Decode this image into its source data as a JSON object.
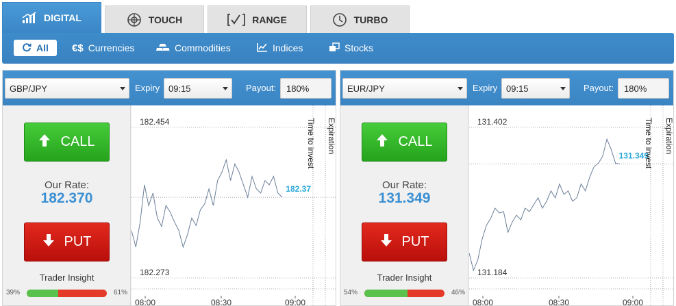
{
  "tabs": [
    {
      "label": "DIGITAL",
      "icon": "chart-up-icon",
      "active": true
    },
    {
      "label": "TOUCH",
      "icon": "target-icon",
      "active": false
    },
    {
      "label": "RANGE",
      "icon": "range-icon",
      "active": false
    },
    {
      "label": "TURBO",
      "icon": "clock-icon",
      "active": false
    }
  ],
  "categories": [
    {
      "label": "All",
      "icon": "refresh-icon",
      "active": true
    },
    {
      "label": "Currencies",
      "icon": "currency-icon",
      "active": false
    },
    {
      "label": "Commodities",
      "icon": "gold-bars-icon",
      "active": false
    },
    {
      "label": "Indices",
      "icon": "line-chart-icon",
      "active": false
    },
    {
      "label": "Stocks",
      "icon": "stocks-icon",
      "active": false
    }
  ],
  "panels": [
    {
      "asset": "GBP/JPY",
      "expiry_label": "Expiry",
      "expiry": "09:15",
      "payout_label": "Payout:",
      "payout": "180%",
      "call_label": "CALL",
      "put_label": "PUT",
      "rate_label": "Our Rate:",
      "rate": "182.370",
      "insight_label": "Trader Insight",
      "insight_put": "39%",
      "insight_call": "61%",
      "insight_fraction": 0.39,
      "chart_data": {
        "type": "line",
        "y_high_label": "182.454",
        "y_low_label": "182.273",
        "current_label": "182.37",
        "x_ticks": [
          "08:00",
          "08:30",
          "09:00"
        ],
        "markers": [
          "Time to invest",
          "Expiration"
        ],
        "x": [
          0,
          2,
          4,
          6,
          8,
          10,
          12,
          14,
          16,
          18,
          20,
          22,
          24,
          26,
          28,
          30,
          32,
          34,
          36,
          38,
          40,
          42,
          44,
          46,
          48,
          50,
          52,
          54,
          56,
          58,
          60,
          62,
          64,
          66,
          68,
          70
        ],
        "values": [
          182.33,
          182.31,
          182.34,
          182.385,
          182.36,
          182.375,
          182.345,
          182.335,
          182.36,
          182.352,
          182.34,
          182.33,
          182.31,
          182.325,
          182.345,
          182.336,
          182.355,
          182.362,
          182.38,
          182.36,
          182.39,
          182.4,
          182.415,
          182.39,
          182.41,
          182.4,
          182.385,
          182.37,
          182.395,
          182.38,
          182.375,
          182.39,
          182.385,
          182.395,
          182.375,
          182.37
        ],
        "current": 182.37
      }
    },
    {
      "asset": "EUR/JPY",
      "expiry_label": "Expiry",
      "expiry": "09:15",
      "payout_label": "Payout:",
      "payout": "180%",
      "call_label": "CALL",
      "put_label": "PUT",
      "rate_label": "Our Rate:",
      "rate": "131.349",
      "insight_label": "Trader Insight",
      "insight_put": "54%",
      "insight_call": "46%",
      "insight_fraction": 0.54,
      "chart_data": {
        "type": "line",
        "y_high_label": "131.402",
        "y_low_label": "131.184",
        "current_label": "131.349",
        "x_ticks": [
          "08:00",
          "08:30",
          "09:00"
        ],
        "markers": [
          "Time to invest",
          "Expiration"
        ],
        "x": [
          0,
          2,
          4,
          6,
          8,
          10,
          12,
          14,
          16,
          18,
          20,
          22,
          24,
          26,
          28,
          30,
          32,
          34,
          36,
          38,
          40,
          42,
          44,
          46,
          48,
          50,
          52,
          54,
          56,
          58,
          60,
          62,
          64,
          66,
          68,
          70
        ],
        "values": [
          131.22,
          131.195,
          131.21,
          131.24,
          131.26,
          131.27,
          131.285,
          131.278,
          131.28,
          131.25,
          131.265,
          131.275,
          131.268,
          131.285,
          131.28,
          131.29,
          131.3,
          131.285,
          131.295,
          131.31,
          131.3,
          131.32,
          131.305,
          131.31,
          131.295,
          131.3,
          131.32,
          131.31,
          131.33,
          131.345,
          131.35,
          131.36,
          131.385,
          131.37,
          131.35,
          131.349
        ],
        "current": 131.349
      }
    }
  ]
}
